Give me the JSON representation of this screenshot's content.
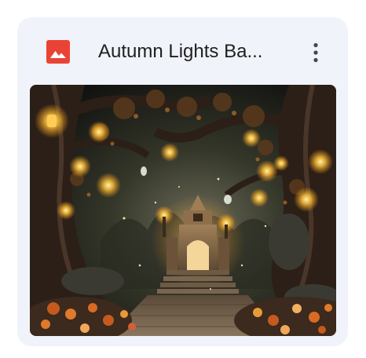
{
  "file_card": {
    "title": "Autumn Lights Ba...",
    "file_type_icon": "image-file-icon",
    "more_options_icon": "more-vert-icon",
    "thumbnail": {
      "description": "autumn forest with glowing lanterns and a stone archway",
      "icon": "image-thumbnail"
    }
  },
  "colors": {
    "card_background": "#f0f3f9",
    "image_icon_red": "#ea4335",
    "title_text": "#1f1f1f",
    "icon_gray": "#444746"
  }
}
